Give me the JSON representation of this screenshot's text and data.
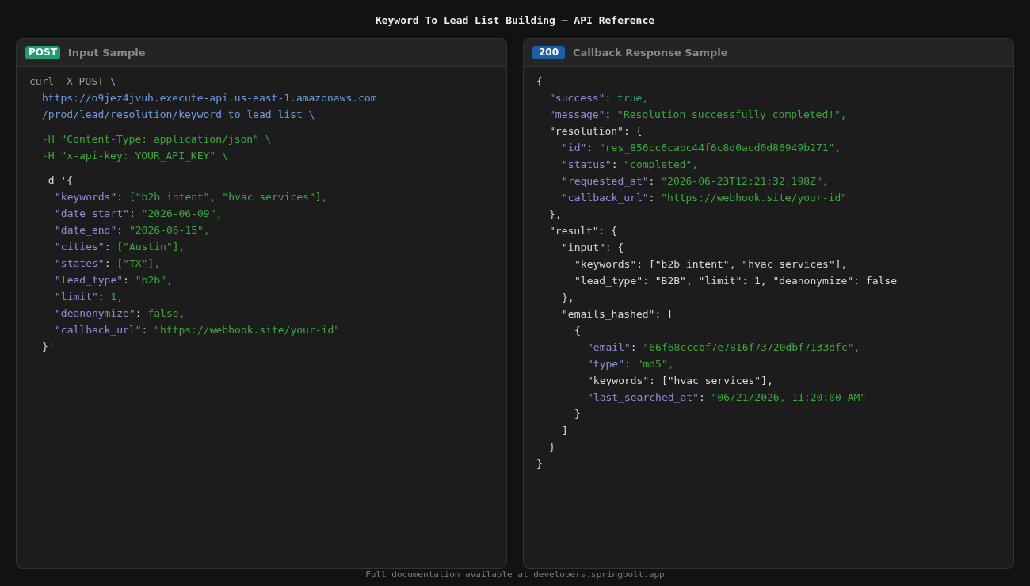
{
  "title": "Keyword To Lead List Building — API Reference",
  "panels": [
    {
      "badge": {
        "kind": "method",
        "text": "POST"
      },
      "title": "Input Sample",
      "code": [
        {
          "tokens": [
            {
              "kind": "muted",
              "text": "curl -X POST \\"
            }
          ],
          "groups": [
            [
              {
                "tokens": [
                  {
                    "kind": "url",
                    "text": "https://o9jez4jvuh.execute-api.us-east-1.amazonaws.com"
                  }
                ]
              },
              {
                "tokens": [
                  {
                    "kind": "url",
                    "text": "/prod/lead/resolution/keyword_to_lead_list \\"
                  }
                ]
              }
            ],
            [
              {
                "tokens": [
                  {
                    "kind": "str",
                    "text": "-H \"Content-Type: application/json\" \\"
                  }
                ]
              },
              {
                "tokens": [
                  {
                    "kind": "str",
                    "text": "-H \"x-api-key: YOUR_API_KEY\" \\"
                  }
                ]
              }
            ],
            [
              {
                "tokens": [
                  {
                    "kind": "plain",
                    "text": "-d '{"
                  }
                ],
                "children": [
                  {
                    "tokens": [
                      {
                        "kind": "key",
                        "text": "\"keywords\""
                      },
                      {
                        "kind": "plain",
                        "text": ": "
                      },
                      {
                        "kind": "str",
                        "text": "[\"b2b intent\", \"hvac services\"],"
                      }
                    ]
                  },
                  {
                    "tokens": [
                      {
                        "kind": "key",
                        "text": "\"date_start\""
                      },
                      {
                        "kind": "plain",
                        "text": ": "
                      },
                      {
                        "kind": "str",
                        "text": "\"2026-06-09\","
                      }
                    ]
                  },
                  {
                    "tokens": [
                      {
                        "kind": "key",
                        "text": "\"date_end\""
                      },
                      {
                        "kind": "plain",
                        "text": ": "
                      },
                      {
                        "kind": "str",
                        "text": "\"2026-06-15\","
                      }
                    ]
                  },
                  {
                    "tokens": [
                      {
                        "kind": "key",
                        "text": "\"cities\""
                      },
                      {
                        "kind": "plain",
                        "text": ": "
                      },
                      {
                        "kind": "str",
                        "text": "[\"Austin\"],"
                      }
                    ]
                  },
                  {
                    "tokens": [
                      {
                        "kind": "key",
                        "text": "\"states\""
                      },
                      {
                        "kind": "plain",
                        "text": ": "
                      },
                      {
                        "kind": "str",
                        "text": "[\"TX\"],"
                      }
                    ]
                  },
                  {
                    "tokens": [
                      {
                        "kind": "key",
                        "text": "\"lead_type\""
                      },
                      {
                        "kind": "plain",
                        "text": ": "
                      },
                      {
                        "kind": "str",
                        "text": "\"b2b\","
                      }
                    ]
                  },
                  {
                    "tokens": [
                      {
                        "kind": "key",
                        "text": "\"limit\""
                      },
                      {
                        "kind": "plain",
                        "text": ": "
                      },
                      {
                        "kind": "str",
                        "text": "1,"
                      }
                    ]
                  },
                  {
                    "tokens": [
                      {
                        "kind": "key",
                        "text": "\"deanonymize\""
                      },
                      {
                        "kind": "plain",
                        "text": ": "
                      },
                      {
                        "kind": "str",
                        "text": "false,"
                      }
                    ]
                  },
                  {
                    "tokens": [
                      {
                        "kind": "key",
                        "text": "\"callback_url\""
                      },
                      {
                        "kind": "plain",
                        "text": ": "
                      },
                      {
                        "kind": "str",
                        "text": "\"https://webhook.site/your-id\""
                      }
                    ]
                  }
                ]
              },
              {
                "tokens": [
                  {
                    "kind": "plain",
                    "text": "}'"
                  }
                ]
              }
            ]
          ]
        }
      ]
    },
    {
      "badge": {
        "kind": "status",
        "text": "200"
      },
      "title": "Callback Response Sample",
      "code": [
        {
          "tokens": [
            {
              "kind": "plain",
              "text": "{"
            }
          ],
          "children": [
            {
              "tokens": [
                {
                  "kind": "key",
                  "text": "\"success\""
                },
                {
                  "kind": "plain",
                  "text": ": "
                },
                {
                  "kind": "bool",
                  "text": "true,"
                }
              ]
            },
            {
              "tokens": [
                {
                  "kind": "key",
                  "text": "\"message\""
                },
                {
                  "kind": "plain",
                  "text": ": "
                },
                {
                  "kind": "str",
                  "text": "\"Resolution successfully completed!\","
                }
              ]
            },
            {
              "tokens": [
                {
                  "kind": "plain",
                  "text": "\"resolution\": {"
                }
              ],
              "children": [
                {
                  "tokens": [
                    {
                      "kind": "key",
                      "text": "\"id\""
                    },
                    {
                      "kind": "plain",
                      "text": ": "
                    },
                    {
                      "kind": "str",
                      "text": "\"res_856cc6cabc44f6c8d0acd0d86949b271\","
                    }
                  ]
                },
                {
                  "tokens": [
                    {
                      "kind": "key",
                      "text": "\"status\""
                    },
                    {
                      "kind": "plain",
                      "text": ": "
                    },
                    {
                      "kind": "str",
                      "text": "\"completed\","
                    }
                  ]
                },
                {
                  "tokens": [
                    {
                      "kind": "key",
                      "text": "\"requested_at\""
                    },
                    {
                      "kind": "plain",
                      "text": ": "
                    },
                    {
                      "kind": "str",
                      "text": "\"2026-06-23T12:21:32.198Z\","
                    }
                  ]
                },
                {
                  "tokens": [
                    {
                      "kind": "key",
                      "text": "\"callback_url\""
                    },
                    {
                      "kind": "plain",
                      "text": ": "
                    },
                    {
                      "kind": "str",
                      "text": "\"https://webhook.site/your-id\""
                    }
                  ]
                }
              ]
            },
            {
              "tokens": [
                {
                  "kind": "plain",
                  "text": "},"
                }
              ]
            },
            {
              "tokens": [
                {
                  "kind": "plain",
                  "text": "\"result\": {"
                }
              ],
              "children": [
                {
                  "tokens": [
                    {
                      "kind": "plain",
                      "text": "\"input\": {"
                    }
                  ],
                  "children": [
                    {
                      "tokens": [
                        {
                          "kind": "plain",
                          "text": "\"keywords\": [\"b2b intent\", \"hvac services\"],"
                        }
                      ]
                    },
                    {
                      "tokens": [
                        {
                          "kind": "plain",
                          "text": "\"lead_type\": \"B2B\", \"limit\": 1, \"deanonymize\": false"
                        }
                      ]
                    }
                  ]
                },
                {
                  "tokens": [
                    {
                      "kind": "plain",
                      "text": "},"
                    }
                  ]
                },
                {
                  "tokens": [
                    {
                      "kind": "plain",
                      "text": "\"emails_hashed\": ["
                    }
                  ],
                  "children": [
                    {
                      "tokens": [
                        {
                          "kind": "plain",
                          "text": "{"
                        }
                      ],
                      "children": [
                        {
                          "tokens": [
                            {
                              "kind": "key",
                              "text": "\"email\""
                            },
                            {
                              "kind": "plain",
                              "text": ": "
                            },
                            {
                              "kind": "str",
                              "text": "\"66f68cccbf7e7816f73720dbf7133dfc\","
                            }
                          ]
                        },
                        {
                          "tokens": [
                            {
                              "kind": "key",
                              "text": "\"type\""
                            },
                            {
                              "kind": "plain",
                              "text": ": "
                            },
                            {
                              "kind": "str",
                              "text": "\"md5\","
                            }
                          ]
                        },
                        {
                          "tokens": [
                            {
                              "kind": "plain",
                              "text": "\"keywords\": [\"hvac services\"],"
                            }
                          ]
                        },
                        {
                          "tokens": [
                            {
                              "kind": "key",
                              "text": "\"last_searched_at\""
                            },
                            {
                              "kind": "plain",
                              "text": ": "
                            },
                            {
                              "kind": "str",
                              "text": "\"06/21/2026, 11:20:00 AM\""
                            }
                          ]
                        }
                      ]
                    },
                    {
                      "tokens": [
                        {
                          "kind": "plain",
                          "text": "}"
                        }
                      ]
                    }
                  ]
                },
                {
                  "tokens": [
                    {
                      "kind": "plain",
                      "text": "]"
                    }
                  ]
                }
              ]
            },
            {
              "tokens": [
                {
                  "kind": "plain",
                  "text": "}"
                }
              ]
            }
          ]
        },
        {
          "tokens": [
            {
              "kind": "plain",
              "text": "}"
            }
          ]
        }
      ]
    }
  ],
  "footer": "Full documentation available at developers.springbolt.app"
}
